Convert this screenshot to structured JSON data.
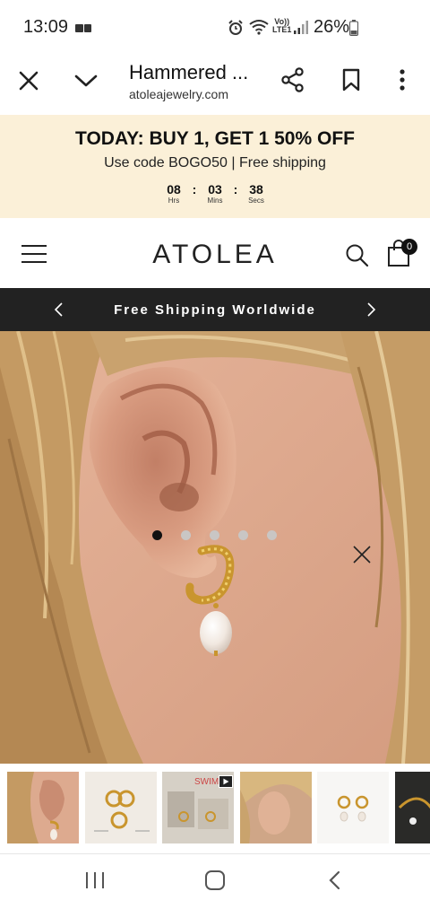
{
  "status_bar": {
    "time": "13:09",
    "volte_line1": "Vo))",
    "volte_line2": "LTE1",
    "battery": "26%"
  },
  "browser": {
    "title": "Hammered ...",
    "url": "atoleajewelry.com",
    "icons": [
      "close-icon",
      "chevron-down-icon",
      "share-icon",
      "bookmark-icon",
      "more-vert-icon"
    ]
  },
  "promo": {
    "headline": "TODAY: BUY 1, GET 1 50% OFF",
    "subline": "Use code BOGO50 | Free shipping",
    "countdown": [
      {
        "value": "08",
        "label": "Hrs"
      },
      {
        "value": "03",
        "label": "Mins"
      },
      {
        "value": "38",
        "label": "Secs"
      }
    ],
    "separator": ":",
    "background": "#fbf0d8"
  },
  "header": {
    "logo": "ATOLEA",
    "cart_count": "0",
    "icons": [
      "menu-icon",
      "search-icon",
      "bag-icon"
    ]
  },
  "announcement": {
    "text": "Free Shipping Worldwide",
    "background": "#222222"
  },
  "gallery": {
    "slide_count": 5,
    "active_slide": 1,
    "thumbnail_count": 6,
    "swim_label": "SWIM"
  },
  "navbar": {
    "icons": [
      "recents-icon",
      "home-icon",
      "back-icon"
    ]
  }
}
